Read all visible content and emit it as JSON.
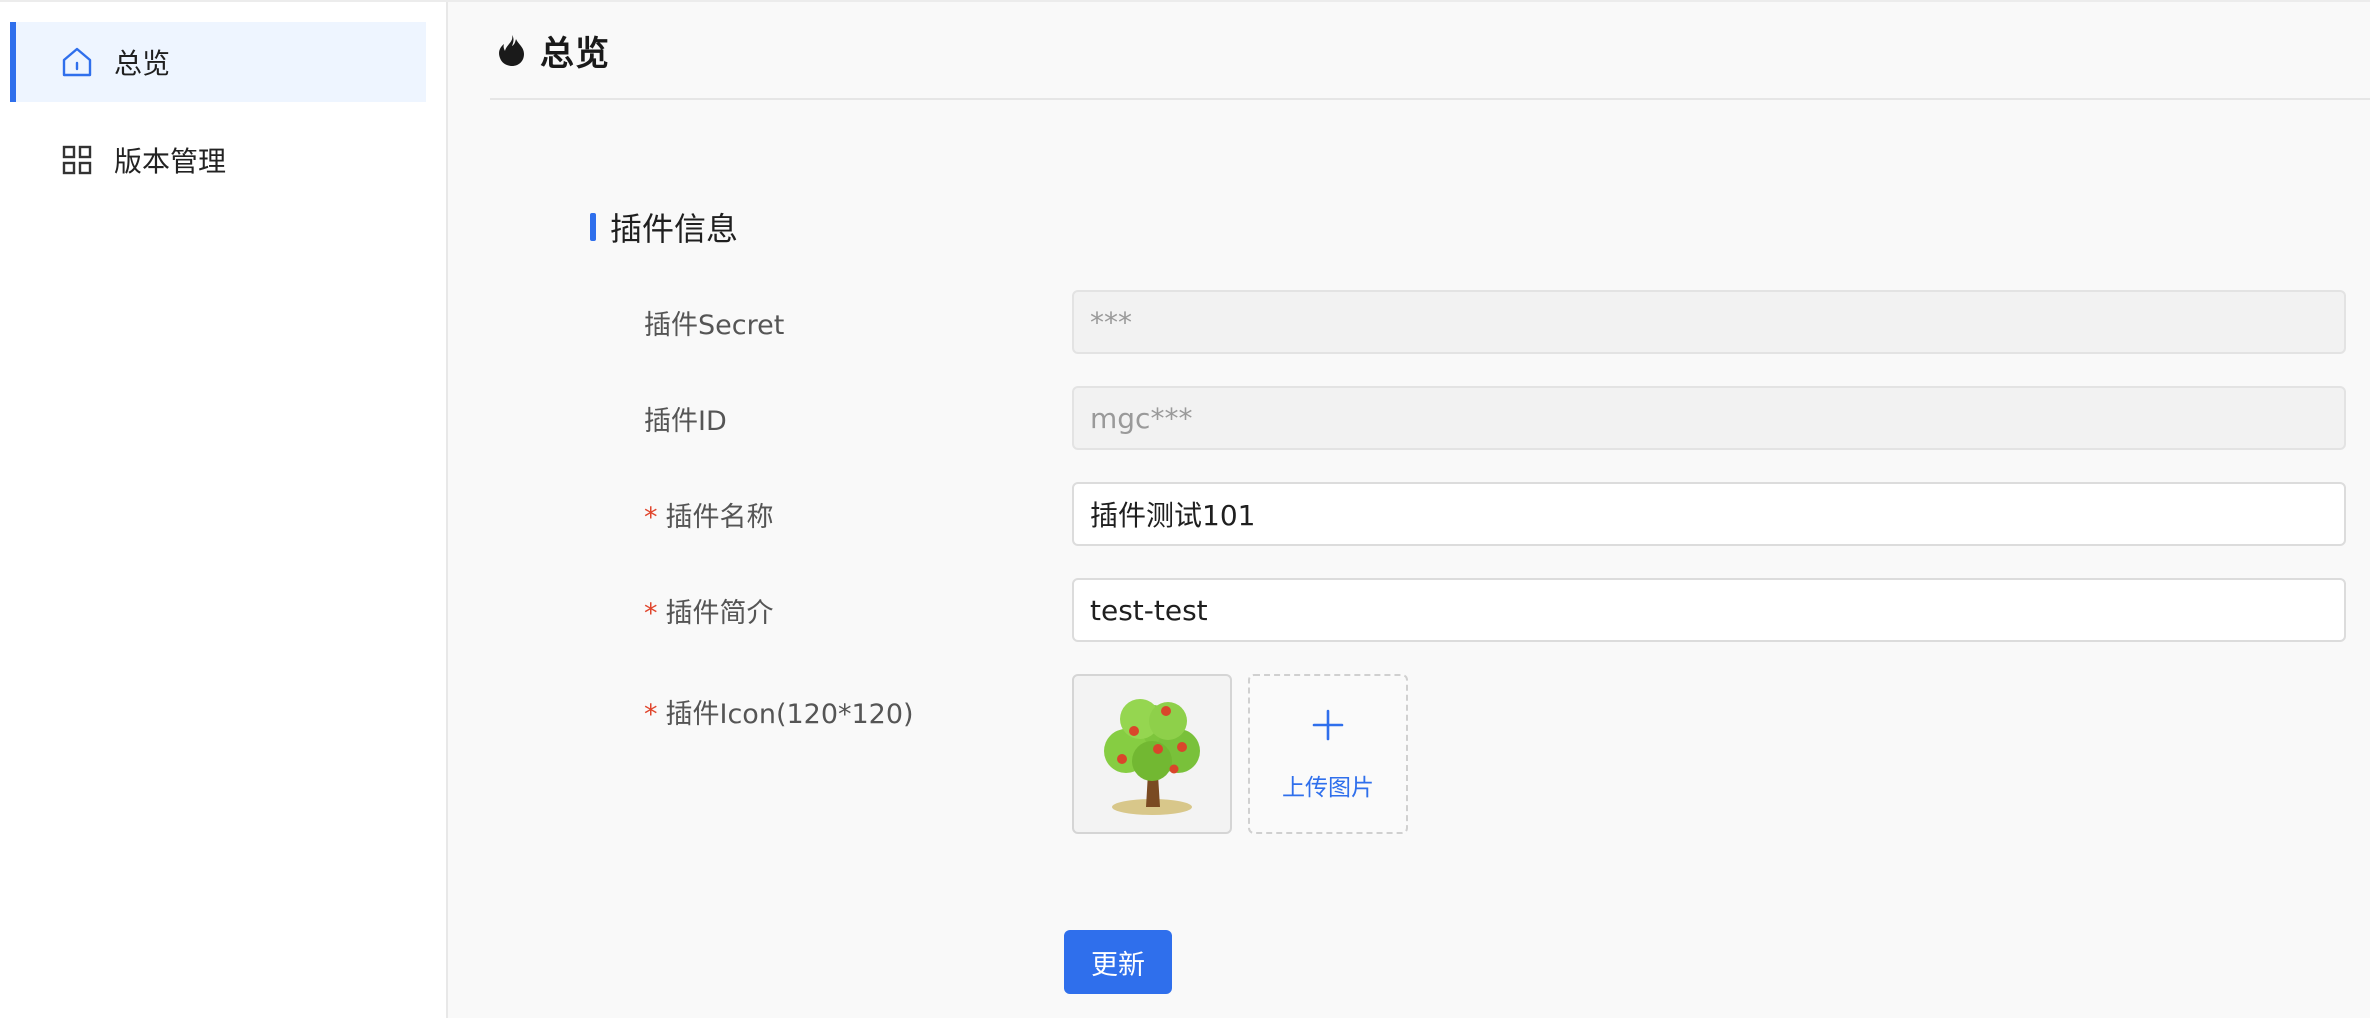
{
  "sidebar": {
    "items": [
      {
        "label": "总览",
        "icon": "home-icon",
        "active": true
      },
      {
        "label": "版本管理",
        "icon": "grid-icon",
        "active": false
      }
    ]
  },
  "header": {
    "title": "总览",
    "icon": "flame-icon"
  },
  "section": {
    "title": "插件信息"
  },
  "form": {
    "secret": {
      "label": "插件Secret",
      "value": "***",
      "disabled": true
    },
    "plugin_id": {
      "label": "插件ID",
      "value": "mgc***",
      "disabled": true
    },
    "name": {
      "label": "插件名称",
      "value": "插件测试101",
      "required": true
    },
    "intro": {
      "label": "插件简介",
      "value": "test-test",
      "required": true
    },
    "icon": {
      "label": "插件Icon(120*120)",
      "required": true,
      "upload_label": "上传图片",
      "image": "tree-icon"
    },
    "required_mark": "*"
  },
  "actions": {
    "submit_label": "更新"
  },
  "colors": {
    "accent": "#2f6fec",
    "required": "#e0452c"
  }
}
